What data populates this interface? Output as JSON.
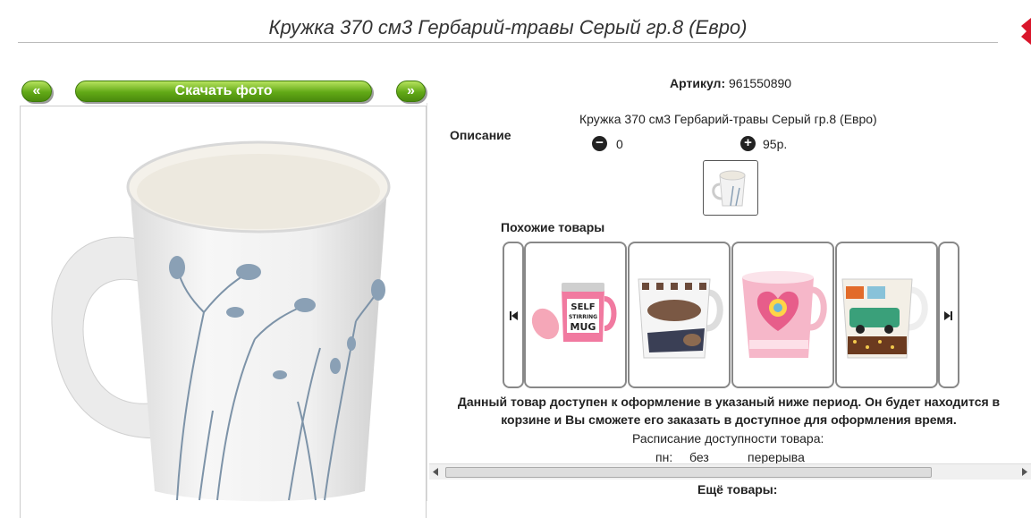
{
  "product": {
    "title": "Кружка 370 см3 Гербарий-травы Серый гр.8 (Евро)",
    "article_label": "Артикул:",
    "article_value": "961550890",
    "description_label": "Описание",
    "description_text": "Кружка 370 см3 Гербарий-травы Серый гр.8 (Евро)",
    "quantity": "0",
    "price": "95р."
  },
  "gallery": {
    "prev_label": "«",
    "download_label": "Скачать фото",
    "next_label": "»"
  },
  "similar": {
    "heading": "Похожие товары",
    "items": [
      {
        "name": "self-stirring-mug",
        "print_line1": "SELF",
        "print_line2": "STIRRING",
        "print_line3": "MUG"
      },
      {
        "name": "chocolate-print-mug"
      },
      {
        "name": "pink-heart-mug"
      },
      {
        "name": "car-print-mug"
      }
    ]
  },
  "availability": {
    "line1": "Данный товар доступен к оформление в указаный ниже период. Он будет находится в",
    "line2": "корзине и Вы сможете его заказать в доступное для оформления время.",
    "schedule_title": "Расписание доступности товара:",
    "day": "пн:",
    "from": "без",
    "to": "перерыва"
  },
  "more": {
    "heading": "Ещё товары:"
  },
  "colors": {
    "green": "#62a916",
    "close_red": "#d9162b"
  }
}
